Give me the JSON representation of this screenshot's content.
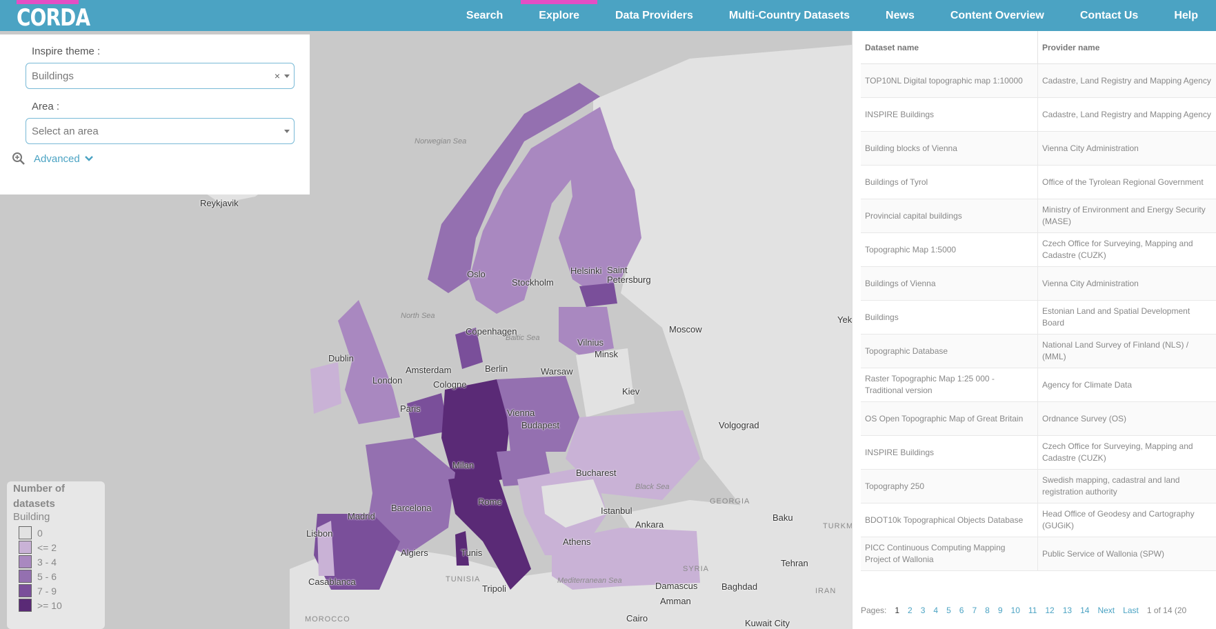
{
  "header": {
    "logo": "CORDA",
    "nav": [
      {
        "label": "Search",
        "active": false
      },
      {
        "label": "Explore",
        "active": true
      },
      {
        "label": "Data Providers",
        "active": false
      },
      {
        "label": "Multi-Country Datasets",
        "active": false
      },
      {
        "label": "News",
        "active": false
      },
      {
        "label": "Content Overview",
        "active": false
      },
      {
        "label": "Contact Us",
        "active": false
      },
      {
        "label": "Help",
        "active": false
      }
    ]
  },
  "filters": {
    "theme_label": "Inspire theme :",
    "theme_value": "Buildings",
    "theme_clear": "×",
    "area_label": "Area :",
    "area_placeholder": "Select an area",
    "advanced_label": "Advanced",
    "advanced_icon": "zoom-in-icon",
    "chevron_icon": "chevron-down-icon"
  },
  "map": {
    "cities": [
      "Reykjavik",
      "Oslo",
      "Stockholm",
      "Helsinki",
      "Saint Petersburg",
      "Copenhagen",
      "Moscow",
      "Vilnius",
      "Minsk",
      "Dublin",
      "Amsterdam",
      "Berlin",
      "Warsaw",
      "London",
      "Cologne",
      "Kiev",
      "Paris",
      "Vienna",
      "Budapest",
      "Volgograd",
      "Milan",
      "Bucharest",
      "Barcelona",
      "Rome",
      "Madrid",
      "Istanbul",
      "Ankara",
      "Lisbon",
      "Algiers",
      "Tunis",
      "Athens",
      "Baku",
      "Tehran",
      "Casablanca",
      "Tripoli",
      "Damascus",
      "Baghdad",
      "Amman",
      "Cairo",
      "Kuwait City",
      "Yek"
    ],
    "seas": [
      "Norwegian Sea",
      "North Sea",
      "Baltic Sea",
      "Black Sea",
      "Mediterranean Sea"
    ],
    "regions": [
      "GEORGIA",
      "TURKM",
      "SYRIA",
      "IRAN",
      "TUNISIA",
      "MOROCCO"
    ]
  },
  "legend": {
    "title": "Number of datasets",
    "subtitle": "Building",
    "items": [
      {
        "label": "0",
        "color": "#e2e2e2"
      },
      {
        "label": "<= 2",
        "color": "#c9b2d6"
      },
      {
        "label": "3 - 4",
        "color": "#a988c0"
      },
      {
        "label": "5 - 6",
        "color": "#9470b0"
      },
      {
        "label": "7 - 9",
        "color": "#7a4f9a"
      },
      {
        "label": ">= 10",
        "color": "#5a2a76"
      }
    ]
  },
  "table": {
    "headers": [
      "Dataset name",
      "Provider name"
    ],
    "rows": [
      [
        "TOP10NL Digital topographic map 1:10000",
        "Cadastre, Land Registry and Mapping Agency"
      ],
      [
        "INSPIRE Buildings",
        "Cadastre, Land Registry and Mapping Agency"
      ],
      [
        "Building blocks of Vienna",
        "Vienna City Administration"
      ],
      [
        "Buildings of Tyrol",
        "Office of the Tyrolean Regional Government"
      ],
      [
        "Provincial capital buildings",
        "Ministry of Environment and Energy Security (MASE)"
      ],
      [
        "Topographic Map 1:5000",
        "Czech Office for Surveying, Mapping and Cadastre (CUZK)"
      ],
      [
        "Buildings of Vienna",
        "Vienna City Administration"
      ],
      [
        "Buildings",
        "Estonian Land and Spatial Development Board"
      ],
      [
        "Topographic Database",
        "National Land Survey of Finland (NLS) / (MML)"
      ],
      [
        "Raster Topographic Map 1:25 000 - Traditional version",
        "Agency for Climate Data"
      ],
      [
        "OS Open Topographic Map of Great Britain",
        "Ordnance Survey (OS)"
      ],
      [
        "INSPIRE Buildings",
        "Czech Office for Surveying, Mapping and Cadastre (CUZK)"
      ],
      [
        "Topography 250",
        "Swedish mapping, cadastral and land registration authority"
      ],
      [
        "BDOT10k Topographical Objects Database",
        "Head Office of Geodesy and Cartography (GUGiK)"
      ],
      [
        "PICC Continuous Computing Mapping Project of Wallonia",
        "Public Service of Wallonia (SPW)"
      ]
    ],
    "pager": {
      "label": "Pages:",
      "pages": [
        "1",
        "2",
        "3",
        "4",
        "5",
        "6",
        "7",
        "8",
        "9",
        "10",
        "11",
        "12",
        "13",
        "14"
      ],
      "current": "1",
      "next": "Next",
      "last": "Last",
      "summary": "1 of 14 (20"
    }
  }
}
